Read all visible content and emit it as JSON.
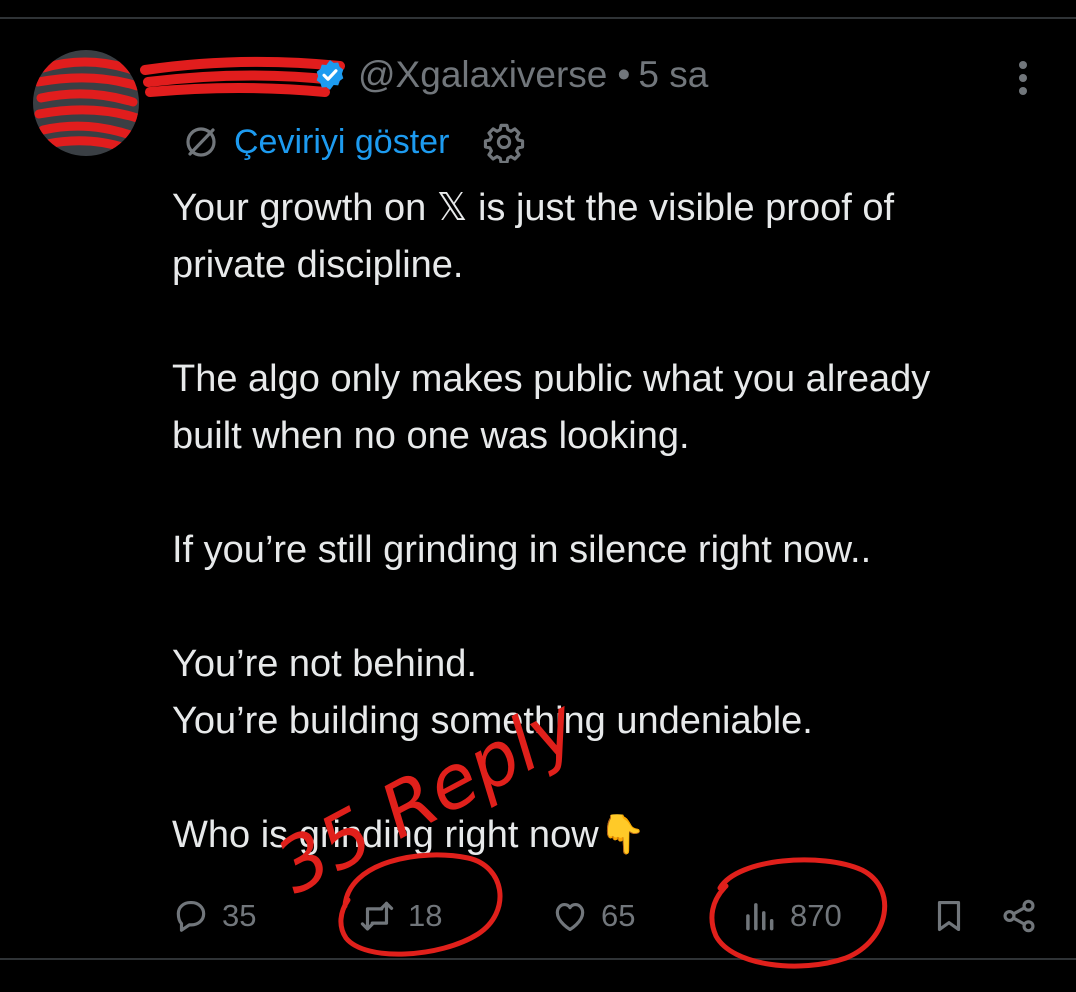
{
  "post": {
    "handle": "@Xgalaxiverse",
    "separator": "•",
    "time": "5 sa",
    "translate_label": "Çeviriyi göster",
    "lines": [
      "Your growth on 𝕏 is just the visible proof of",
      "private discipline.",
      "",
      "The algo only makes public what you already",
      "built when no one was looking.",
      "",
      "If you’re still grinding in silence right now..",
      "",
      "You’re not behind.",
      "You’re building something undeniable.",
      "",
      "Who is grinding right now👇"
    ]
  },
  "actions": {
    "replies": "35",
    "reposts": "18",
    "likes": "65",
    "views": "870"
  },
  "annotation": {
    "text": "35 Reply",
    "color": "#e0201b"
  },
  "icons": {
    "verified": "verified-badge-icon",
    "more": "more-vertical-icon",
    "translate": "translate-icon",
    "settings": "gear-icon",
    "reply": "reply-bubble-icon",
    "repost": "repost-icon",
    "like": "heart-icon",
    "views": "views-bars-icon",
    "bookmark": "bookmark-icon",
    "share": "share-icon"
  },
  "colors": {
    "background": "#000000",
    "text": "#e7e9ea",
    "muted": "#71767b",
    "accent": "#1d9bf0"
  }
}
